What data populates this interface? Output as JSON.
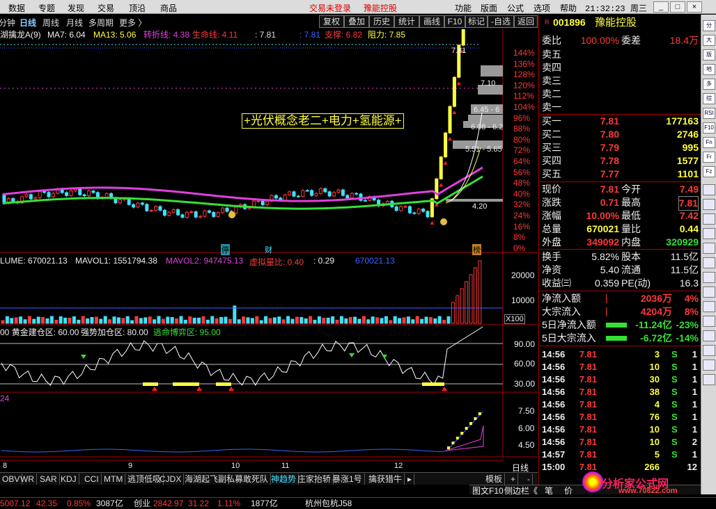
{
  "menu": {
    "items": [
      "数据",
      "专题",
      "发现",
      "交易",
      "顶沿",
      "商品"
    ],
    "login": "交易未登录",
    "stock_title": "豫能控股",
    "right": [
      "功能",
      "版面",
      "公式",
      "选项",
      "帮助"
    ],
    "clock": "21:32:23",
    "weekday": "周三",
    "min": "_",
    "max": "□",
    "close": "×"
  },
  "period": {
    "items": [
      "分钟",
      "日线",
      "周线",
      "月线",
      "多周期",
      "更多"
    ],
    "active": "日线"
  },
  "toolbar": {
    "items": [
      "复权",
      "叠加",
      "历史",
      "统计",
      "画线",
      "F10",
      "标记",
      "-自选",
      "返回"
    ]
  },
  "indicator_line": {
    "name": "湖擒龙A(9)",
    "ma7": "MA7: 6.04",
    "ma13": "MA13: 5.06",
    "zz": "转折线: 4.38",
    "sm": "生命线: 4.11",
    "v1": ": 7.81",
    "v2": ": 7.81",
    "zc": "支撑: 6.82",
    "zl": "阻力: 7.85"
  },
  "chart_annotation": "+光伏概念老二+电力+氢能源+",
  "price_labels": {
    "top": "7.81",
    "l1": "7.10",
    "l2": "6.45 - 6",
    "l3": "6.08 - 6.2",
    "l4": "5.51 - 5.65",
    "low": "4.20"
  },
  "pct_axis": [
    "144%",
    "136%",
    "128%",
    "120%",
    "112%",
    "104%",
    "96%",
    "88%",
    "80%",
    "72%",
    "64%",
    "56%",
    "48%",
    "40%",
    "32%",
    "24%",
    "16%",
    "8%",
    "0%"
  ],
  "markers": {
    "m1": "停",
    "m2": "财",
    "m3": "榜"
  },
  "volume": {
    "label": "LUME: 670021.13",
    "mavol1": "MAVOL1: 1551794.38",
    "mavol2": "MAVOL2: 947475.13",
    "xnlb": "虚拟量比: 0.40",
    "v": ": 0.29",
    "v2": "670021.13",
    "axis": [
      "20000",
      "10000"
    ],
    "unit": "X100"
  },
  "osc": {
    "l1": "黄金建仓区: 60.00",
    "l2": "强势加仓区: 80.00",
    "l3": "逃命博弈区: 95.00",
    "axis": [
      "90.00",
      "60.00",
      "30.00"
    ]
  },
  "sub4": {
    "label": "24",
    "axis": [
      "7.50",
      "6.00",
      "4.50"
    ]
  },
  "dates": [
    "8",
    "9",
    "10",
    "11",
    "12"
  ],
  "period_label": "日线",
  "tabs": {
    "items": [
      "OBV",
      "WR",
      "SAR",
      "KDJ",
      "CCI",
      "MTM",
      "逃顶低吸",
      "CJDX",
      "海湖起飞副",
      "私募敢死队",
      "神趋势",
      "庄家抬轿",
      "暴涨1号",
      "擒获猎牛"
    ],
    "active": "神趋势",
    "more": "▸",
    "template": "模板",
    "plus": "+",
    "minus": "-"
  },
  "quote": {
    "code": "001896",
    "name": "豫能控股",
    "prefix": "R",
    "wb_label": "委比",
    "wb": "100.00%",
    "wc_label": "委差",
    "wc": "18.4万",
    "sells": [
      {
        "label": "卖五"
      },
      {
        "label": "卖四"
      },
      {
        "label": "卖三"
      },
      {
        "label": "卖二"
      },
      {
        "label": "卖一"
      }
    ],
    "buys": [
      {
        "label": "买一",
        "price": "7.81",
        "vol": "177163"
      },
      {
        "label": "买二",
        "price": "7.80",
        "vol": "2746"
      },
      {
        "label": "买三",
        "price": "7.79",
        "vol": "995"
      },
      {
        "label": "买四",
        "price": "7.78",
        "vol": "1577"
      },
      {
        "label": "买五",
        "price": "7.77",
        "vol": "1101"
      }
    ],
    "stats": [
      {
        "l1": "现价",
        "v1": "7.81",
        "l2": "今开",
        "v2": "7.49"
      },
      {
        "l1": "涨跌",
        "v1": "0.71",
        "l2": "最高",
        "v2": "7.81"
      },
      {
        "l1": "涨幅",
        "v1": "10.00%",
        "l2": "最低",
        "v2": "7.42"
      },
      {
        "l1": "总量",
        "v1": "670021",
        "l2": "量比",
        "v2": "0.44"
      },
      {
        "l1": "外盘",
        "v1": "349092",
        "l2": "内盘",
        "v2": "320929"
      }
    ],
    "extra": [
      {
        "l1": "换手",
        "v1": "5.82%",
        "l2": "股本",
        "v2": "11.5亿"
      },
      {
        "l1": "净资",
        "v1": "5.40",
        "l2": "流通",
        "v2": "11.5亿"
      },
      {
        "l1": "收益㈢",
        "v1": "0.359",
        "l2": "PE(动)",
        "v2": "16.3"
      }
    ],
    "flows": [
      {
        "label": "净流入额",
        "value": "2036万",
        "pct": "4%"
      },
      {
        "label": "大宗流入",
        "value": "4204万",
        "pct": "8%"
      },
      {
        "label": "5日净流入额",
        "value": "-11.24亿",
        "pct": "-23%"
      },
      {
        "label": "5日大宗流入",
        "value": "-6.72亿",
        "pct": "-14%"
      }
    ],
    "ticks": [
      {
        "t": "14:56",
        "p": "7.81",
        "v": "3",
        "s": "S",
        "n": "1"
      },
      {
        "t": "14:56",
        "p": "7.81",
        "v": "10",
        "s": "S",
        "n": "1"
      },
      {
        "t": "14:56",
        "p": "7.81",
        "v": "30",
        "s": "S",
        "n": "1"
      },
      {
        "t": "14:56",
        "p": "7.81",
        "v": "38",
        "s": "S",
        "n": "1"
      },
      {
        "t": "14:56",
        "p": "7.81",
        "v": "4",
        "s": "S",
        "n": "1"
      },
      {
        "t": "14:56",
        "p": "7.81",
        "v": "76",
        "s": "S",
        "n": "1"
      },
      {
        "t": "14:56",
        "p": "7.81",
        "v": "10",
        "s": "S",
        "n": "1"
      },
      {
        "t": "14:56",
        "p": "7.81",
        "v": "10",
        "s": "S",
        "n": "2"
      },
      {
        "t": "14:57",
        "p": "7.81",
        "v": "5",
        "s": "S",
        "n": "1"
      },
      {
        "t": "15:00",
        "p": "7.81",
        "v": "266",
        "s": "",
        "n": "12"
      }
    ],
    "f10": "图文F10",
    "side": "侧边栏《",
    "bi": "笔",
    "jia": "价"
  },
  "status": {
    "idx1": "5007.12",
    "ch1": "42.35",
    "pc1": "0.85%",
    "amt1": "3087亿",
    "name2": "创业",
    "idx2": "2842.97",
    "ch2": "31.22",
    "pc2": "1.11%",
    "amt2": "1877亿",
    "stock": "杭州包杭J58"
  },
  "watermark": {
    "name": "分析家公式网",
    "url": "www.70822.com"
  },
  "side_icons": [
    "分",
    "大",
    "版",
    "地",
    "多",
    "综",
    "RSI",
    "F10",
    "Fn",
    "Fr",
    "Fz"
  ],
  "colors": {
    "bg": "#000000",
    "red": "#ff3838",
    "green": "#36e036",
    "yellow": "#ffff40",
    "cyan": "#40e0ff",
    "magenta": "#e040e0"
  }
}
